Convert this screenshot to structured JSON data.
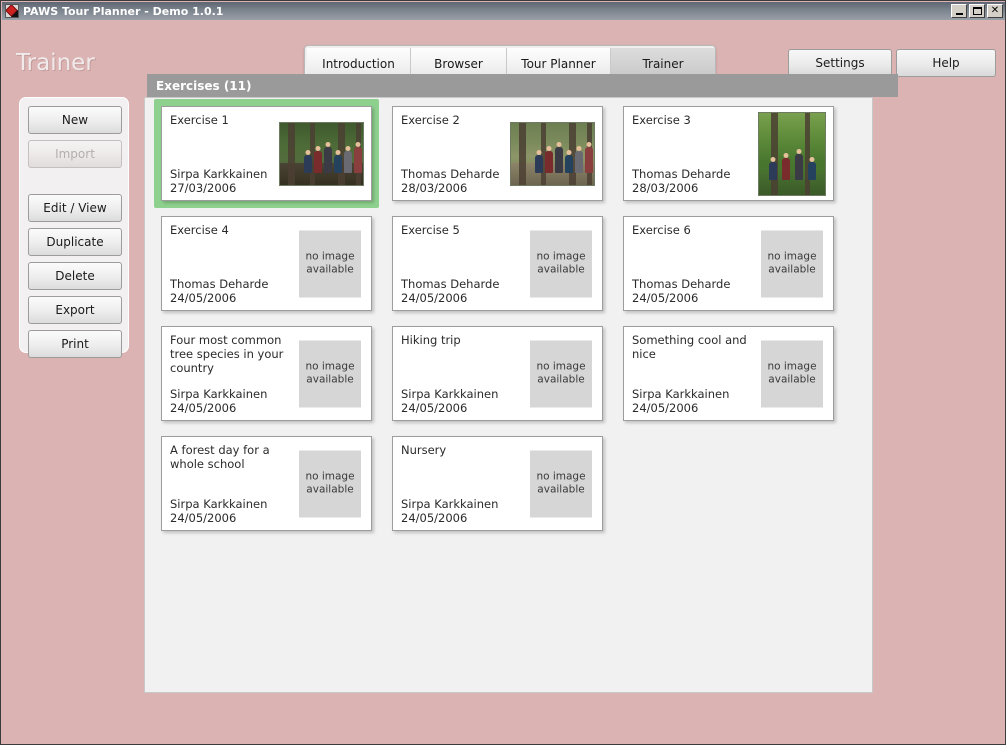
{
  "window": {
    "title": "PAWS Tour Planner - Demo 1.0.1",
    "icon": "paws-diamond-icon",
    "minimize_label": "",
    "maximize_label": "",
    "close_label": "✕"
  },
  "header": {
    "page_title": "Trainer",
    "tabs": [
      {
        "label": "Introduction",
        "selected": false
      },
      {
        "label": "Browser",
        "selected": false
      },
      {
        "label": "Tour Planner",
        "selected": false
      },
      {
        "label": "Trainer",
        "selected": true
      }
    ],
    "buttons": [
      {
        "label": "Settings"
      },
      {
        "label": "Help"
      }
    ]
  },
  "sidebar": {
    "items": [
      {
        "label": "New",
        "disabled": false
      },
      {
        "label": "Import",
        "disabled": true
      },
      {
        "label": "Edit / View",
        "disabled": false
      },
      {
        "label": "Duplicate",
        "disabled": false
      },
      {
        "label": "Delete",
        "disabled": false
      },
      {
        "label": "Export",
        "disabled": false
      },
      {
        "label": "Print",
        "disabled": false
      }
    ]
  },
  "main": {
    "section_header": "Exercises (11)",
    "no_image_text": "no image\navailable",
    "selected_color": "#8ed18e",
    "cards": [
      {
        "title": "Exercise 1",
        "author": "Sirpa Karkkainen",
        "date": "27/03/2006",
        "thumb": "photo",
        "photo_variant": "photo-1",
        "selected": true
      },
      {
        "title": "Exercise 2",
        "author": "Thomas Deharde",
        "date": "28/03/2006",
        "thumb": "photo",
        "photo_variant": "photo-2",
        "selected": false
      },
      {
        "title": "Exercise 3",
        "author": "Thomas Deharde",
        "date": "28/03/2006",
        "thumb": "photo",
        "photo_variant": "photo-3",
        "selected": false
      },
      {
        "title": "Exercise 4",
        "author": "Thomas Deharde",
        "date": "24/05/2006",
        "thumb": "noimage",
        "selected": false
      },
      {
        "title": "Exercise 5",
        "author": "Thomas Deharde",
        "date": "24/05/2006",
        "thumb": "noimage",
        "selected": false
      },
      {
        "title": "Exercise 6",
        "author": "Thomas Deharde",
        "date": "24/05/2006",
        "thumb": "noimage",
        "selected": false
      },
      {
        "title": "Four most common tree species in your country",
        "author": "Sirpa Karkkainen",
        "date": "24/05/2006",
        "thumb": "noimage",
        "selected": false
      },
      {
        "title": "Hiking trip",
        "author": "Sirpa Karkkainen",
        "date": "24/05/2006",
        "thumb": "noimage",
        "selected": false
      },
      {
        "title": "Something cool and nice",
        "author": "Sirpa Karkkainen",
        "date": "24/05/2006",
        "thumb": "noimage",
        "selected": false
      },
      {
        "title": "A forest day for a whole school",
        "author": "Sirpa Karkkainen",
        "date": "24/05/2006",
        "thumb": "noimage",
        "selected": false
      },
      {
        "title": "Nursery",
        "author": "Sirpa Karkkainen",
        "date": "24/05/2006",
        "thumb": "noimage",
        "selected": false
      }
    ]
  },
  "colors": {
    "window_background": "#dcb3b3",
    "titlebar": "#7b838d",
    "panel": "#f1f1f1",
    "section_header": "#9a9a9a",
    "selection": "#8ed18e"
  }
}
